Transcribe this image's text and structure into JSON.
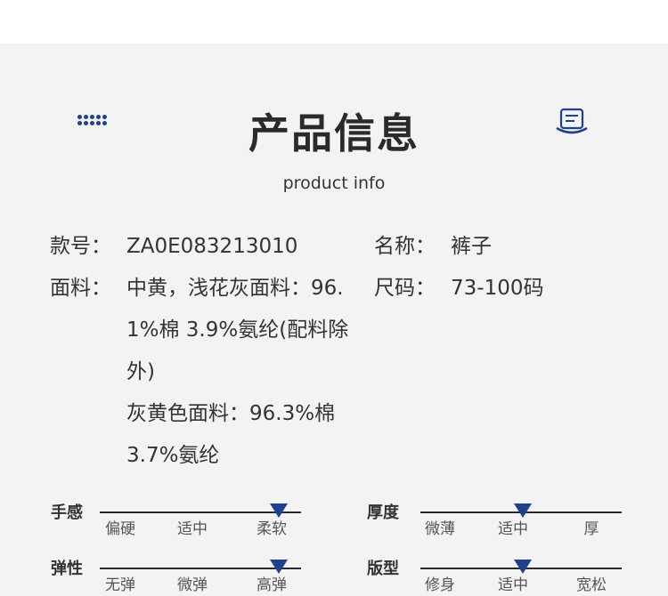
{
  "header": {
    "title": "产品信息",
    "subtitle": "product info",
    "left_icon": "grid-dots-icon",
    "right_icon": "note-icon",
    "accent_color": "#1f3f8f"
  },
  "info": {
    "style_no": {
      "label": "款号：",
      "value": "ZA0E083213010"
    },
    "name": {
      "label": "名称：",
      "value": "裤子"
    },
    "fabric": {
      "label": "面料：",
      "lines": [
        "中黄，浅花灰面料：96.",
        "1%棉 3.9%氨纶(配料除",
        "外)",
        "灰黄色面料：96.3%棉",
        "3.7%氨纶"
      ]
    },
    "size": {
      "label": "尺码：",
      "value": "73-100码"
    }
  },
  "scales": [
    {
      "title": "手感",
      "ticks": [
        "偏硬",
        "适中",
        "柔软"
      ],
      "level": 1.0
    },
    {
      "title": "厚度",
      "ticks": [
        "微薄",
        "适中",
        "厚"
      ],
      "level": 0.5
    },
    {
      "title": "弹性",
      "ticks": [
        "无弹",
        "微弹",
        "高弹"
      ],
      "level": 1.0
    },
    {
      "title": "版型",
      "ticks": [
        "修身",
        "适中",
        "宽松"
      ],
      "level": 0.5
    }
  ]
}
